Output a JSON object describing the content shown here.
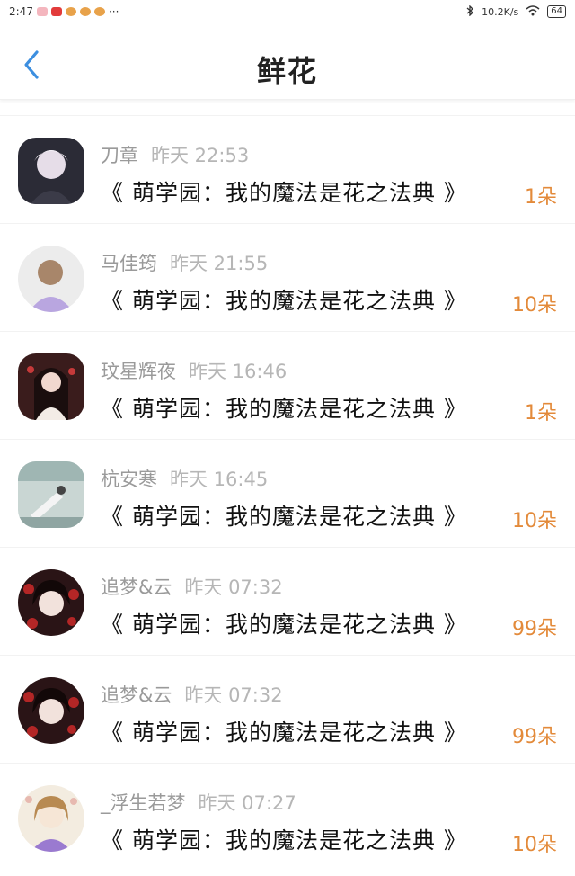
{
  "status_bar": {
    "time": "2:47",
    "dots": "···",
    "network_speed": "10.2K/s",
    "battery": "64"
  },
  "header": {
    "title": "鲜花"
  },
  "colors": {
    "accent_blue": "#3d8fe0",
    "flower_orange": "#e38a3a"
  },
  "rows": [
    {
      "name": "刀章",
      "time": "昨天 22:53",
      "book": "《 萌学园：我的魔法是花之法典 》",
      "flowers": "1朵"
    },
    {
      "name": "马佳筠",
      "time": "昨天 21:55",
      "book": "《 萌学园：我的魔法是花之法典 》",
      "flowers": "10朵"
    },
    {
      "name": "玟星辉夜",
      "time": "昨天 16:46",
      "book": "《 萌学园：我的魔法是花之法典 》",
      "flowers": "1朵"
    },
    {
      "name": "杭安寒",
      "time": "昨天 16:45",
      "book": "《 萌学园：我的魔法是花之法典 》",
      "flowers": "10朵"
    },
    {
      "name": "追梦&云",
      "time": "昨天 07:32",
      "book": "《 萌学园：我的魔法是花之法典 》",
      "flowers": "99朵"
    },
    {
      "name": "追梦&云",
      "time": "昨天 07:32",
      "book": "《 萌学园：我的魔法是花之法典 》",
      "flowers": "99朵"
    },
    {
      "name": "_浮生若梦",
      "time": "昨天 07:27",
      "book": "《 萌学园：我的魔法是花之法典 》",
      "flowers": "10朵"
    }
  ]
}
